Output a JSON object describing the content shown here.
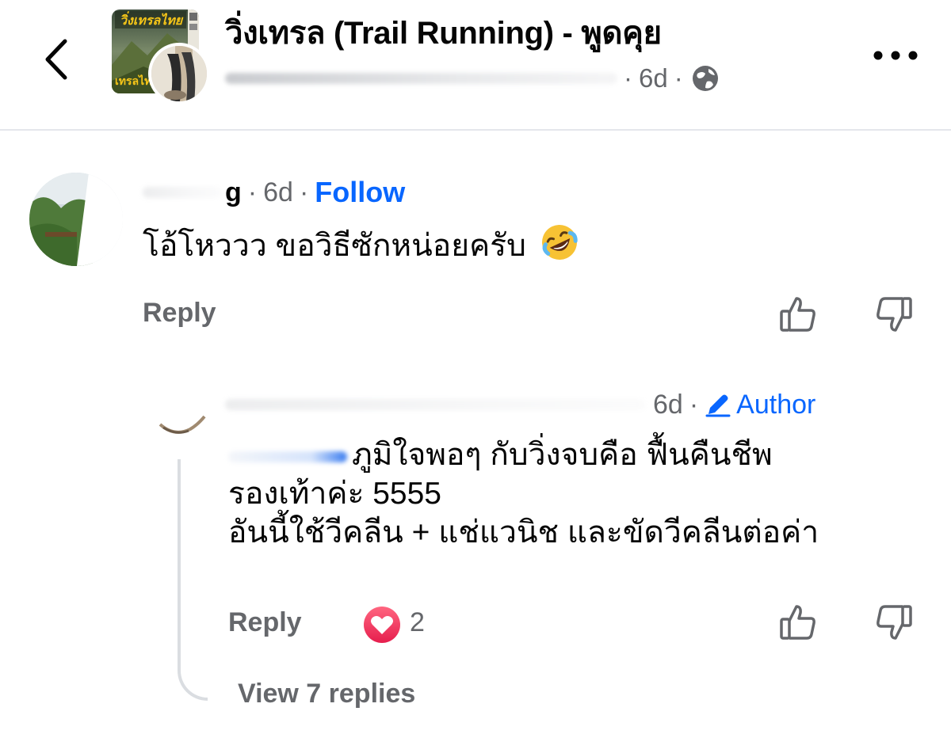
{
  "header": {
    "group_title": "วิ่งเทรล (Trail Running) - พูดคุย",
    "post_age": "6d",
    "separator": "·",
    "thumb_label_top": "วิ่งเทรลไทย",
    "thumb_label_bottom": "เทรลไทย"
  },
  "comments": [
    {
      "author_visible_fragment": "g",
      "age": "6d",
      "follow_label": "Follow",
      "text": "โอ้โหววว ขอวิธีซักหน่อยครับ",
      "reply_label": "Reply"
    },
    {
      "age": "6d",
      "author_badge": "Author",
      "text_lines": [
        "ภูมิใจพอๆ กับวิ่งจบคือ ฟื้นคืนชีพ",
        "รองเท้าค่ะ 5555",
        "อันนี้ใช้วีคลีน + แช่แวนิช และขัดวีคลีนต่อค่า"
      ],
      "reply_label": "Reply",
      "reaction_count": "2",
      "view_replies_label": "View 7 replies"
    }
  ],
  "colors": {
    "link_blue": "#0866ff",
    "secondary_text": "#65676b",
    "primary_text": "#050505",
    "divider": "#e4e6eb",
    "heart_red": "#f33e58"
  },
  "icons": {
    "back": "chevron-left-icon",
    "more": "more-horizontal-icon",
    "privacy": "globe-icon",
    "like": "thumbs-up-icon",
    "dislike": "thumbs-down-icon",
    "reaction": "heart-reaction-icon",
    "author": "pencil-icon",
    "emoji": "rolling-on-floor-laughing-emoji"
  }
}
